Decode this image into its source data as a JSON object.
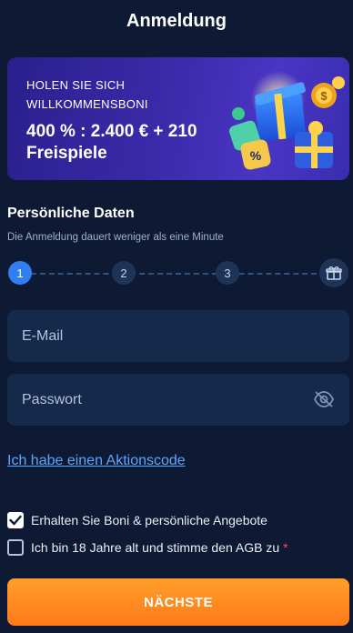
{
  "header": {
    "title": "Anmeldung"
  },
  "banner": {
    "eyebrow": "HOLEN SIE SICH WILLKOMMENSBONI",
    "offer": "400 % : 2.400 € + 210 Freispiele"
  },
  "personal": {
    "title": "Persönliche Daten",
    "subtitle": "Die Anmeldung dauert weniger als eine Minute"
  },
  "stepper": {
    "steps": [
      "1",
      "2",
      "3"
    ],
    "active_step": 1,
    "final_icon": "gift-icon"
  },
  "form": {
    "email_placeholder": "E-Mail",
    "password_placeholder": "Passwort",
    "password_toggle_icon": "eye-off-icon"
  },
  "promo_link": "Ich habe einen Aktionscode",
  "checkboxes": [
    {
      "label": "Erhalten Sie Boni & persönliche Angebote",
      "checked": true,
      "required": false
    },
    {
      "label": "Ich bin 18 Jahre alt und stimme den AGB zu",
      "checked": false,
      "required": true,
      "required_mark": "*"
    }
  ],
  "next_button": "NÄCHSTE",
  "colors": {
    "background": "#0e1a33",
    "field": "#15294b",
    "accent_blue": "#2f7ff0",
    "link": "#5aa6ff",
    "button": "#ff8a1f",
    "required": "#ff4b4b"
  }
}
